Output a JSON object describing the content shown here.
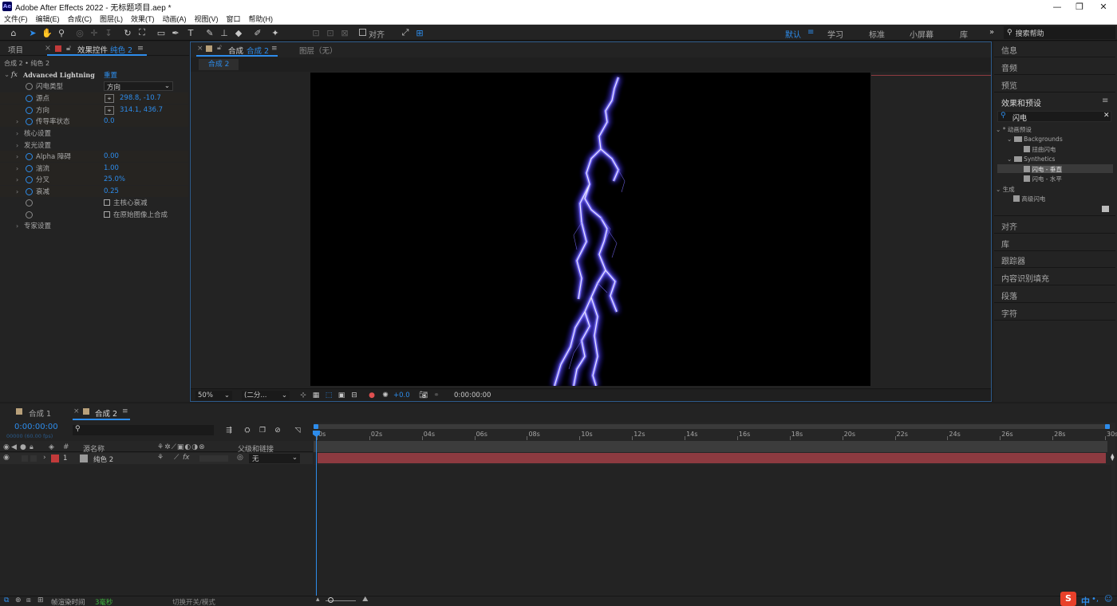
{
  "app": {
    "logo": "Ae",
    "title": "Adobe After Effects 2022 - 无标题项目.aep *",
    "window_controls": [
      "—",
      "❐",
      "✕"
    ]
  },
  "menu": [
    "文件(F)",
    "编辑(E)",
    "合成(C)",
    "图层(L)",
    "效果(T)",
    "动画(A)",
    "视图(V)",
    "窗口",
    "帮助(H)"
  ],
  "toolbar": {
    "align_label": "对齐",
    "workspaces": [
      "默认",
      "学习",
      "标准",
      "小屏幕",
      "库"
    ],
    "workspace_more": "»",
    "search_help": "搜索帮助"
  },
  "left_panel": {
    "tab_project": "项目",
    "tab_effects": "效果控件",
    "tab_effects_target": "纯色 2",
    "breadcrumb": "合成 2 • 纯色 2",
    "effect_name": "Advanced Lightning",
    "reset_label": "重置",
    "params": [
      {
        "label": "闪电类型",
        "value": "方向",
        "kind": "dropdown"
      },
      {
        "label": "源点",
        "value": "298.8, -10.7",
        "kind": "point"
      },
      {
        "label": "方向",
        "value": "314.1, 436.7",
        "kind": "point"
      },
      {
        "label": "传导率状态",
        "value": "0.0",
        "kind": "value"
      },
      {
        "label": "核心设置",
        "kind": "group"
      },
      {
        "label": "发光设置",
        "kind": "group"
      },
      {
        "label": "Alpha 障碍",
        "value": "0.00",
        "kind": "value"
      },
      {
        "label": "湍流",
        "value": "1.00",
        "kind": "value"
      },
      {
        "label": "分叉",
        "value": "25.0%",
        "kind": "value"
      },
      {
        "label": "衰减",
        "value": "0.25",
        "kind": "value"
      },
      {
        "label": "主核心衰减",
        "kind": "checkbox"
      },
      {
        "label": "在原始图像上合成",
        "kind": "checkbox"
      },
      {
        "label": "专家设置",
        "kind": "group"
      }
    ]
  },
  "viewer": {
    "tab_label": "合成",
    "tab_comp": "合成 2",
    "layer_tab": "图层（无）",
    "sub_tab": "合成 2",
    "zoom": "50%",
    "resolution": "(二分...",
    "exposure": "+0.0",
    "timecode": "0:00:00:00"
  },
  "right_panel": {
    "info": "信息",
    "audio": "音频",
    "preview": "预览",
    "effects_presets": "效果和预设",
    "search_value": "闪电",
    "tree": [
      {
        "label": "* 动画预设",
        "level": 0,
        "kind": "folder-open"
      },
      {
        "label": "Backgrounds",
        "level": 1,
        "kind": "folder"
      },
      {
        "label": "扭曲闪电",
        "level": 2,
        "kind": "preset"
      },
      {
        "label": "Synthetics",
        "level": 1,
        "kind": "folder"
      },
      {
        "label": "闪电 - 垂直",
        "level": 2,
        "kind": "preset",
        "selected": true
      },
      {
        "label": "闪电 - 水平",
        "level": 2,
        "kind": "preset"
      },
      {
        "label": "生成",
        "level": 0,
        "kind": "folder-open"
      },
      {
        "label": "高级闪电",
        "level": 1,
        "kind": "effect"
      }
    ],
    "panels": [
      "对齐",
      "库",
      "跟踪器",
      "内容识别填充",
      "段落",
      "字符"
    ]
  },
  "timeline": {
    "tabs": [
      {
        "label": "合成 1",
        "color": "#b8a07a"
      },
      {
        "label": "合成 2",
        "color": "#b8a07a",
        "active": true
      }
    ],
    "current_time": "0:00:00:00",
    "frame_info": "00000 (60.00 fps)",
    "search_placeholder": "",
    "col_source": "源名称",
    "col_parent": "父级和链接",
    "ticks": [
      "0s",
      "02s",
      "04s",
      "06s",
      "08s",
      "10s",
      "12s",
      "14s",
      "16s",
      "18s",
      "20s",
      "22s",
      "24s",
      "26s",
      "28s",
      "30s"
    ],
    "layers": [
      {
        "index": "1",
        "name": "纯色 2",
        "parent": "无",
        "color": "#c23a3a",
        "bar_color": "#8d3a40"
      }
    ]
  },
  "status": {
    "render_label": "帧渲染时间",
    "render_value": "3毫秒",
    "toggle_label": "切换开关/模式"
  },
  "ime": {
    "logo": "S",
    "lang": "中"
  }
}
